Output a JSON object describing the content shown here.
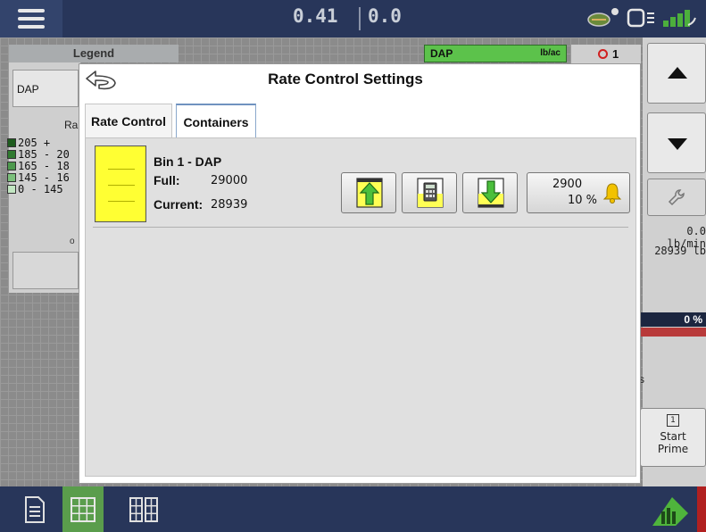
{
  "topbar": {
    "value_left": "0.41",
    "value_right": "0.0",
    "icons": [
      "menu-icon",
      "seed-icon",
      "display-icon",
      "gps-signal-icon"
    ]
  },
  "legend": {
    "header": "Legend",
    "product_button": "DAP",
    "rate_label": "Ra",
    "items": [
      {
        "label": "205 +",
        "color": "#1e5c1e"
      },
      {
        "label": "185 - 20",
        "color": "#2f7a2f"
      },
      {
        "label": "165 - 18",
        "color": "#4d994d"
      },
      {
        "label": "145 - 16",
        "color": "#7bbf7b"
      },
      {
        "label": "0 - 145",
        "color": "#c2e6c2"
      }
    ],
    "small_text": "o"
  },
  "product_bar": {
    "name": "DAP",
    "unit": "lb/ac"
  },
  "count_box": {
    "value": "1"
  },
  "right_panel": {
    "rate": "0.0 lb/min",
    "total": "28939 lb",
    "percent": "0 %",
    "fragment": "s",
    "prime_icon_label": "1",
    "prime_label_line1": "Start",
    "prime_label_line2": "Prime"
  },
  "dialog": {
    "title": "Rate Control Settings",
    "tabs": [
      {
        "label": "Rate Control",
        "active": false
      },
      {
        "label": "Containers",
        "active": true
      }
    ],
    "bin": {
      "name": "Bin 1 - DAP",
      "full_label": "Full:",
      "full_value": "29000",
      "current_label": "Current:",
      "current_value": "28939"
    },
    "alarm": {
      "value": "2900",
      "percent": "10 %"
    }
  },
  "colors": {
    "accent_green": "#5a9d4c",
    "bin_yellow": "#ffff33",
    "topbar_blue": "#28365a"
  }
}
